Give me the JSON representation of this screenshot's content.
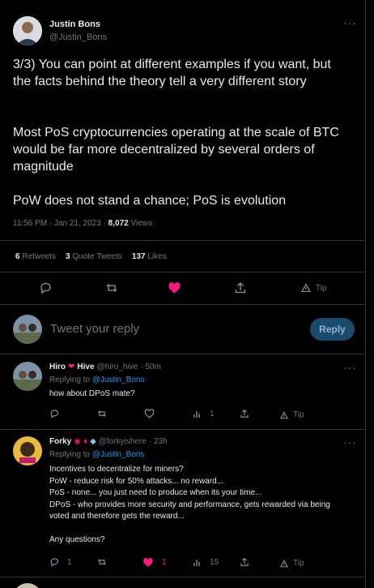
{
  "main_tweet": {
    "author_name": "Justin Bons",
    "author_handle": "@Justin_Bons",
    "para1": "3/3) You can point at different examples if you want, but the facts behind the theory tell a very different story",
    "para2": "Most PoS cryptocurrencies operating at the scale of BTC would be far more decentralized by several orders of magnitude",
    "para3": "PoW does not stand a chance; PoS is evolution",
    "time": "11:56 PM · Jan 21, 2023 · ",
    "views_count": "8,072",
    "views_label": " Views",
    "retweets_count": "6",
    "retweets_label": " Retweets",
    "quotes_count": "3",
    "quotes_label": " Quote Tweets",
    "likes_count": "137",
    "likes_label": " Likes",
    "tip_label": "Tip"
  },
  "composer": {
    "placeholder": "Tweet your reply",
    "reply_label": "Reply"
  },
  "replies": [
    {
      "name": "Hiro",
      "name_suffix": "Hive",
      "handle": "@hiro_hive",
      "time": "· 50m",
      "replying_prefix": "Replying to ",
      "replying_to": "@Justin_Bons",
      "text": "how about DPoS mate?",
      "views": "1",
      "tip": "Tip"
    },
    {
      "name": "Forky",
      "handle": "@forkyishere",
      "time": "· 23h",
      "replying_prefix": "Replying to ",
      "replying_to": "@Justin_Bons",
      "lines": [
        "Incentives to decentralize for miners?",
        "PoW - reduce risk for 50% attacks... no reward...",
        "PoS - none... you just need to produce when its your time...",
        "DPoS - who provides more security and performance, gets rewarded via being voted and therefore gets the reward...",
        "",
        "Any questions?"
      ],
      "replies_count": "1",
      "likes_count": "1",
      "views": "15",
      "tip": "Tip"
    }
  ],
  "colors": {
    "accent": "#1d9bf0",
    "like": "#f91880",
    "muted": "#71767b"
  }
}
